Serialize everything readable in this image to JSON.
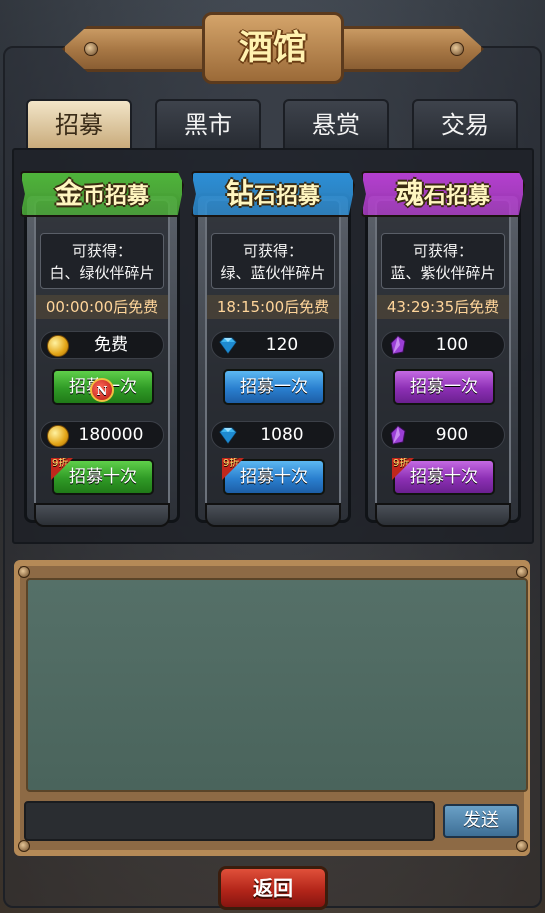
{
  "title": "酒馆",
  "tabs": [
    {
      "label": "招募",
      "active": true
    },
    {
      "label": "黑市",
      "active": false
    },
    {
      "label": "悬赏",
      "active": false
    },
    {
      "label": "交易",
      "active": false
    }
  ],
  "cards": [
    {
      "ribbon_big": "金",
      "ribbon_rest": "币招募",
      "ribbon_color": "#4fb43a",
      "info_line1": "可获得：",
      "info_line2": "白、绿伙伴碎片",
      "timer": "00:00:00后免费",
      "single_cost": "免费",
      "single_icon": "gold-coin-icon",
      "single_button": "招募一次",
      "ten_cost": "180000",
      "ten_icon": "gold-coin-icon",
      "ten_button": "招募十次",
      "discount": "9折",
      "button_color": "green"
    },
    {
      "ribbon_big": "钻",
      "ribbon_rest": "石招募",
      "ribbon_color": "#2d8fd6",
      "info_line1": "可获得：",
      "info_line2": "绿、蓝伙伴碎片",
      "timer": "18:15:00后免费",
      "single_cost": "120",
      "single_icon": "diamond-icon",
      "single_button": "招募一次",
      "ten_cost": "1080",
      "ten_icon": "diamond-icon",
      "ten_button": "招募十次",
      "discount": "9折",
      "button_color": "blue"
    },
    {
      "ribbon_big": "魂",
      "ribbon_rest": "石招募",
      "ribbon_color": "#b43fcf",
      "info_line1": "可获得：",
      "info_line2": "蓝、紫伙伴碎片",
      "timer": "43:29:35后免费",
      "single_cost": "100",
      "single_icon": "soul-stone-icon",
      "single_button": "招募一次",
      "ten_cost": "900",
      "ten_icon": "soul-stone-icon",
      "ten_button": "招募十次",
      "discount": "9折",
      "button_color": "purple"
    }
  ],
  "notification_badge": "N",
  "chat": {
    "input_value": "",
    "send_label": "发送"
  },
  "back_label": "返回"
}
